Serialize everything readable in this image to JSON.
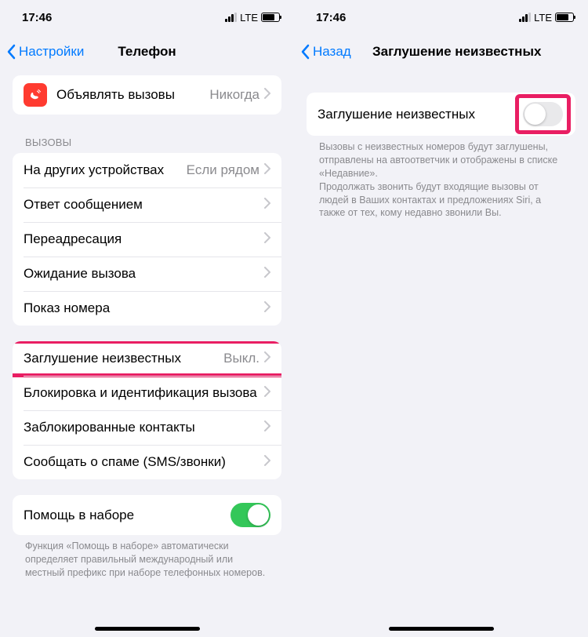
{
  "status": {
    "time": "17:46",
    "network": "LTE"
  },
  "screen1": {
    "nav": {
      "back": "Настройки",
      "title": "Телефон"
    },
    "announce": {
      "label": "Объявлять вызовы",
      "value": "Никогда"
    },
    "calls_header": "ВЫЗОВЫ",
    "calls": {
      "other_devices": {
        "label": "На других устройствах",
        "value": "Если рядом"
      },
      "respond_with_text": {
        "label": "Ответ сообщением"
      },
      "forwarding": {
        "label": "Переадресация"
      },
      "call_waiting": {
        "label": "Ожидание вызова"
      },
      "show_caller_id": {
        "label": "Показ номера"
      }
    },
    "silence": {
      "label": "Заглушение неизвестных",
      "value": "Выкл."
    },
    "blocking": {
      "block_id": {
        "label": "Блокировка и идентификация вызова"
      },
      "blocked_contacts": {
        "label": "Заблокированные контакты"
      },
      "report_spam": {
        "label": "Сообщать о спаме (SMS/звонки)"
      }
    },
    "dial_assist": {
      "label": "Помощь в наборе",
      "on": true
    },
    "dial_assist_note": "Функция «Помощь в наборе» автоматически определяет правильный международный или местный префикс при наборе телефонных номеров."
  },
  "screen2": {
    "nav": {
      "back": "Назад",
      "title": "Заглушение неизвестных"
    },
    "silence": {
      "label": "Заглушение неизвестных",
      "on": false
    },
    "note": "Вызовы с неизвестных номеров будут заглушены, отправлены на автоответчик и отображены в списке «Недавние».\nПродолжать звонить будут входящие вызовы от людей в Ваших контактах и предложениях Siri, а также от тех, кому недавно звонили Вы."
  }
}
